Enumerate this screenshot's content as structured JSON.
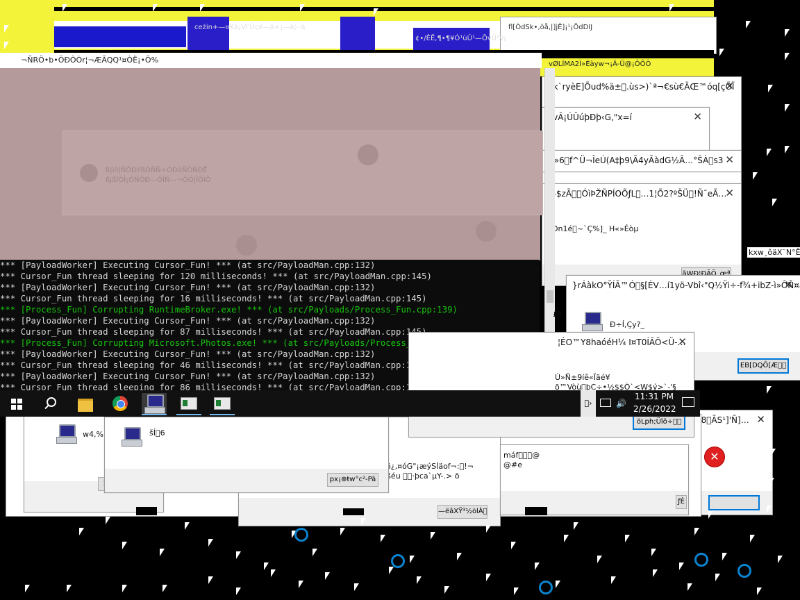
{
  "colors": {
    "accent": "#0078d7",
    "console_green": "#16c60c",
    "glitch_yellow": "#f3f339",
    "glitch_blue": "#2a1ec8"
  },
  "console": {
    "lines": [
      {
        "text": "*** [PayloadWorker] Executing Cursor_Fun! *** (at src/PayloadMan.cpp:132)",
        "color": "white"
      },
      {
        "text": "*** Cursor_Fun thread sleeping for 120 milliseconds! *** (at src/PayloadMan.cpp:145)",
        "color": "white"
      },
      {
        "text": "*** [PayloadWorker] Executing Cursor_Fun! *** (at src/PayloadMan.cpp:132)",
        "color": "white"
      },
      {
        "text": "*** Cursor_Fun thread sleeping for 16 milliseconds! *** (at src/PayloadMan.cpp:145)",
        "color": "white"
      },
      {
        "text": "*** [Process_Fun] Corrupting RuntimeBroker.exe! *** (at src/Payloads/Process_Fun.cpp:139)",
        "color": "green"
      },
      {
        "text": "*** [PayloadWorker] Executing Cursor_Fun! *** (at src/PayloadMan.cpp:132)",
        "color": "white"
      },
      {
        "text": "*** Cursor_Fun thread sleeping for 87 milliseconds! *** (at src/PayloadMan.cpp:145)",
        "color": "white"
      },
      {
        "text": "*** [Process_Fun] Corrupting Microsoft.Photos.exe! *** (at src/Payloads/Process_Fun.cpp:139)",
        "color": "green"
      },
      {
        "text": "*** [PayloadWorker] Executing Cursor_Fun! *** (at src/PayloadMan.cpp:132)",
        "color": "white"
      },
      {
        "text": "*** Cursor_Fun thread sleeping for 46 milliseconds! *** (at src/PayloadMan.cpp:145)",
        "color": "white"
      },
      {
        "text": "*** [PayloadWorker] Executing Cursor_Fun! *** (at src/PayloadMan.cpp:132)",
        "color": "white"
      },
      {
        "text": "*** Cursor_Fun thread sleeping for 86 milliseconds! *** (at src/PayloadMan.cpp:145)",
        "color": "white"
      }
    ]
  },
  "taskbar": {
    "time": "11:31 PM",
    "date": "2/26/2022",
    "icons": [
      "windows-start-icon",
      "search-icon",
      "file-explorer-icon",
      "chrome-icon",
      "computer-app-icon",
      "app-window-icon",
      "app-window-icon"
    ]
  },
  "glitch_titles": {
    "top_tab": "ceżin+—¤Kà¡Vl'Ûçë—ä+¡—ä¦-·ä",
    "top_tab2": "¢•/ÊË,¶•¶¥Ó¹ùÛ¹—ÕvÛ¹ÿ¡",
    "top_right": "fl[ÒdSk•,öå,|]jÊ]¡¹¡ÕdDĲ",
    "window_row": "¬ÑRÖ•b•ÖÐÒÒr¦¬ÆÃQQ¹¤ÒË¡•Õ%",
    "banner_bar": "vØLÍMA2Ì»Éàyw¬¡Â-Ü@¡ÔÔÒ",
    "right_edge": "kxw¸ôäX¨N°Ê"
  },
  "pink_window": {
    "text1": "ß|ìô|ÑÖÐÝßÓÑÑ÷ÓÐòÑÒÑÐË",
    "text2": "ßjßÏÔÌ¡ÔÑÖÐ—ÕÏÑ—¬ÕÓ|ÏÖÏÖ"
  },
  "dialogs": {
    "d1": {
      "title": "3k`ryèE]Õud%ä±\u0000.ùs>)`ª¬€sù€ÄŒ™óq[çÕÏ",
      "x": "✕"
    },
    "d2": {
      "title": "yvÂ¡ÚÛúþÐþ‹G,\"x=í",
      "x": "✕"
    },
    "d3": {
      "title": "Û»6\u0000f^Ü¬ÎeÚ(A‡þ9\\Ã4yÃàdG½Ã…°ŠÀ\u0000s3",
      "x": "✕"
    },
    "d4": {
      "title": "—$zÃ\u0000\u0000ÓìÞŽÑPÍOÕƒL\u0000…1¦Õ2?ºŠÜ\u0000!Ñ¯eÃ…",
      "x": "✕",
      "msg": "Ðn1é\u0000~`Ç%]_ H«»Éòµ",
      "btn": "ãWÐ¦ÐÃÕ_œª"
    },
    "d5": {
      "title": "}rÁàkO°ŸÍÃ™Ó\u0000§[ÉV…í1yö-Vbî‹\"Q½Ÿi÷-f¾+ibZ-ì»ÔÑ¤a»",
      "x": "✕",
      "msg": "Ð÷Í,Çy?_",
      "btn": "EB[DQÔ[Æ\u0000\u0000"
    },
    "d6": {
      "title": "¦ÉO™Y8haóéH¼ I¤T0ÍÄÖ<Ü-…",
      "x": "✕",
      "msg1": "Ù»Ñ±9íê«Ïäé¥",
      "msg2": "õ™Vòù\u0000þC÷•½$$Ò`<W$ý>`-'§",
      "field": "öLph;Üîõ÷\u0000\u0000"
    },
    "d7": {
      "title": "Ë8\u0000ÃS¹]'Ñ]…",
      "x": "✕",
      "btn": ""
    },
    "d8": {
      "msg": "w4,%…",
      "btn": "2"
    },
    "d9": {
      "msg": "šÍ\u00006",
      "btn": "px¡⊕ŧw°c²-Pã"
    },
    "d10": {
      "msg1": "õ¿,¤óG\"¡æýSÍäof¬:\u0000!¬",
      "msg2": "ßéu \u0000\u0000·þca`µY-.> ö",
      "btn": "—ëâXŸ³½òlÀ\u0000"
    },
    "d11": {
      "msg1": "máf\u0000\u0000\u0000@",
      "msg2": "@#e"
    },
    "d12": {
      "btn": "ƒÈ"
    },
    "d13": {
      "top": "0'¥¦ì´Y",
      "x": "✕"
    }
  },
  "misc": {
    "ft": "£ª",
    "mid": "\u0000›"
  }
}
